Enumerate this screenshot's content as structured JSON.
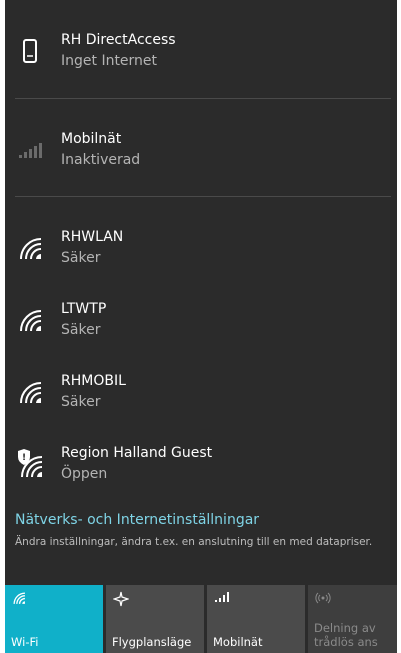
{
  "networks": [
    {
      "name": "RH DirectAccess",
      "status": "Inget Internet",
      "icon": "phone-device-icon"
    },
    {
      "name": "Mobilnät",
      "status": "Inaktiverad",
      "icon": "cellular-signal-icon"
    },
    {
      "name": "RHWLAN",
      "status": "Säker",
      "icon": "wifi-icon"
    },
    {
      "name": "LTWTP",
      "status": "Säker",
      "icon": "wifi-icon"
    },
    {
      "name": "RHMOBIL",
      "status": "Säker",
      "icon": "wifi-icon"
    },
    {
      "name": "Region Halland Guest",
      "status": "Öppen",
      "icon": "wifi-shield-icon"
    }
  ],
  "settings": {
    "link": "Nätverks- och Internetinställningar",
    "description": "Ändra inställningar, ändra t.ex. en anslutning till en med datapriser."
  },
  "quick_actions": [
    {
      "label": "Wi-Fi",
      "state": "active",
      "icon": "wifi-icon"
    },
    {
      "label": "Flygplansläge",
      "state": "off",
      "icon": "airplane-icon"
    },
    {
      "label": "Mobilnät",
      "state": "off",
      "icon": "cellular-signal-icon"
    },
    {
      "label": "Delning av trådlös ans",
      "state": "disabled",
      "icon": "hotspot-icon"
    }
  ],
  "colors": {
    "background": "#2b2b2b",
    "accent": "#10b0c9",
    "link": "#7fd4e6",
    "tile": "#4b4b4b"
  }
}
